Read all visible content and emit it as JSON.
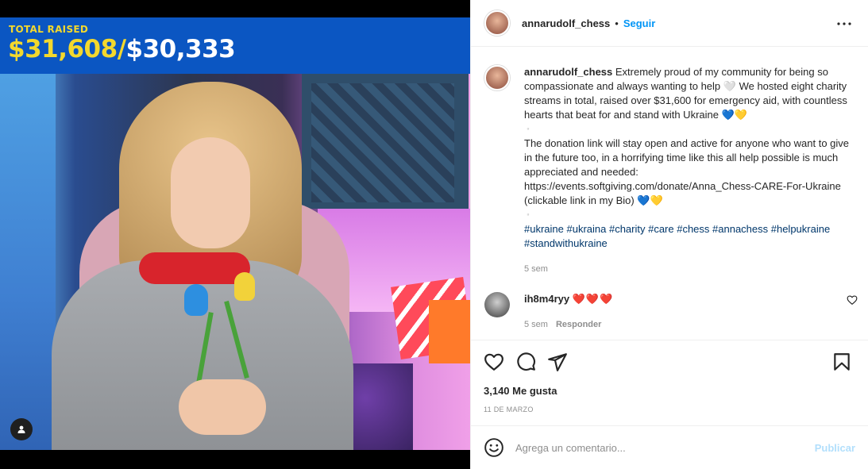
{
  "banner": {
    "label": "TOTAL RAISED",
    "raised": "$31,608/",
    "goal": "$30,333"
  },
  "header": {
    "username": "annarudolf_chess",
    "separator": "•",
    "follow_label": "Seguir"
  },
  "caption": {
    "username": "annarudolf_chess",
    "line1": "Extremely proud of my community for being so compassionate and always wanting to help 🤍 We hosted eight charity streams in total, raised over $31,600 for emergency aid, with countless hearts that beat for and stand with Ukraine 💙💛",
    "spacer1": "▫️",
    "line2": "The donation link will stay open and active for anyone who want to give in the future too, in a horrifying time like this all help possible is much appreciated and needed:",
    "link": "https://events.softgiving.com/donate/Anna_Chess-CARE-For-Ukraine (clickable link in my Bio) 💙💛",
    "spacer2": "▫️",
    "hashtags": "#ukraine #ukraina #charity #care #chess #annachess #helpukraine #standwithukraine",
    "time": "5 sem"
  },
  "comment": {
    "username": "ih8m4ryy",
    "text": "❤️❤️❤️",
    "time": "5 sem",
    "reply_label": "Responder"
  },
  "stats": {
    "likes": "3,140 Me gusta",
    "date": "11 DE MARZO"
  },
  "compose": {
    "placeholder": "Agrega un comentario...",
    "post_label": "Publicar"
  },
  "colors": {
    "banner_blue": "#0b56c2",
    "banner_yellow": "#f3d82d",
    "link_blue": "#0095f6",
    "hashtag": "#00376b",
    "heart_red": "#e0142a"
  },
  "icons": [
    "user-tag-icon",
    "more-options-icon",
    "heart-icon",
    "comment-icon",
    "share-icon",
    "bookmark-icon",
    "emoji-icon",
    "comment-like-icon"
  ]
}
